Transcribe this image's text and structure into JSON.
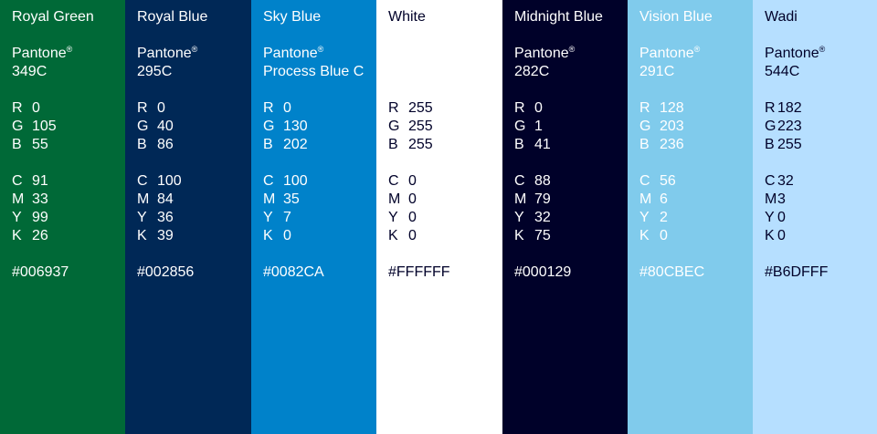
{
  "swatches": [
    {
      "name": "Royal Green",
      "pantone_label": "Pantone",
      "pantone_mark": "®",
      "pantone_code": "349C",
      "rgb": {
        "R": "0",
        "G": "105",
        "B": "55"
      },
      "cmyk": {
        "C": "91",
        "M": "33",
        "Y": "99",
        "K": "26"
      },
      "hex": "#006937",
      "bg": "#006937",
      "fg": "#FFFFFF"
    },
    {
      "name": "Royal Blue",
      "pantone_label": "Pantone",
      "pantone_mark": "®",
      "pantone_code": "295C",
      "rgb": {
        "R": "0",
        "G": "40",
        "B": "86"
      },
      "cmyk": {
        "C": "100",
        "M": "84",
        "Y": "36",
        "K": "39"
      },
      "hex": "#002856",
      "bg": "#002856",
      "fg": "#FFFFFF"
    },
    {
      "name": "Sky Blue",
      "pantone_label": "Pantone",
      "pantone_mark": "®",
      "pantone_code": "Process Blue C",
      "rgb": {
        "R": "0",
        "G": "130",
        "B": "202"
      },
      "cmyk": {
        "C": "100",
        "M": "35",
        "Y": "7",
        "K": "0"
      },
      "hex": "#0082CA",
      "bg": "#0082CA",
      "fg": "#FFFFFF"
    },
    {
      "name": "White",
      "pantone_label": "",
      "pantone_mark": "",
      "pantone_code": "",
      "rgb": {
        "R": "255",
        "G": "255",
        "B": "255"
      },
      "cmyk": {
        "C": "0",
        "M": "0",
        "Y": "0",
        "K": "0"
      },
      "hex": "#FFFFFF",
      "bg": "#FFFFFF",
      "fg": "#000129"
    },
    {
      "name": "Midnight Blue",
      "pantone_label": "Pantone",
      "pantone_mark": "®",
      "pantone_code": "282C",
      "rgb": {
        "R": "0",
        "G": "1",
        "B": "41"
      },
      "cmyk": {
        "C": "88",
        "M": "79",
        "Y": "32",
        "K": "75"
      },
      "hex": "#000129",
      "bg": "#000129",
      "fg": "#FFFFFF"
    },
    {
      "name": "Vision Blue",
      "pantone_label": "Pantone",
      "pantone_mark": "®",
      "pantone_code": "291C",
      "rgb": {
        "R": "128",
        "G": "203",
        "B": "236"
      },
      "cmyk": {
        "C": "56",
        "M": "6",
        "Y": "2",
        "K": "0"
      },
      "hex": "#80CBEC",
      "bg": "#80CBEC",
      "fg": "#FFFFFF"
    },
    {
      "name": "Wadi",
      "pantone_label": "Pantone",
      "pantone_mark": "®",
      "pantone_code": "544C",
      "rgb": {
        "R": "182",
        "G": "223",
        "B": "255"
      },
      "cmyk": {
        "C": "32",
        "M": "3",
        "Y": "0",
        "K": "0"
      },
      "hex": "#B6DFFF",
      "bg": "#B6DFFF",
      "fg": "#000129"
    }
  ],
  "labels": {
    "R": "R",
    "G": "G",
    "B": "B",
    "C": "C",
    "M": "M",
    "Y": "Y",
    "K": "K"
  }
}
